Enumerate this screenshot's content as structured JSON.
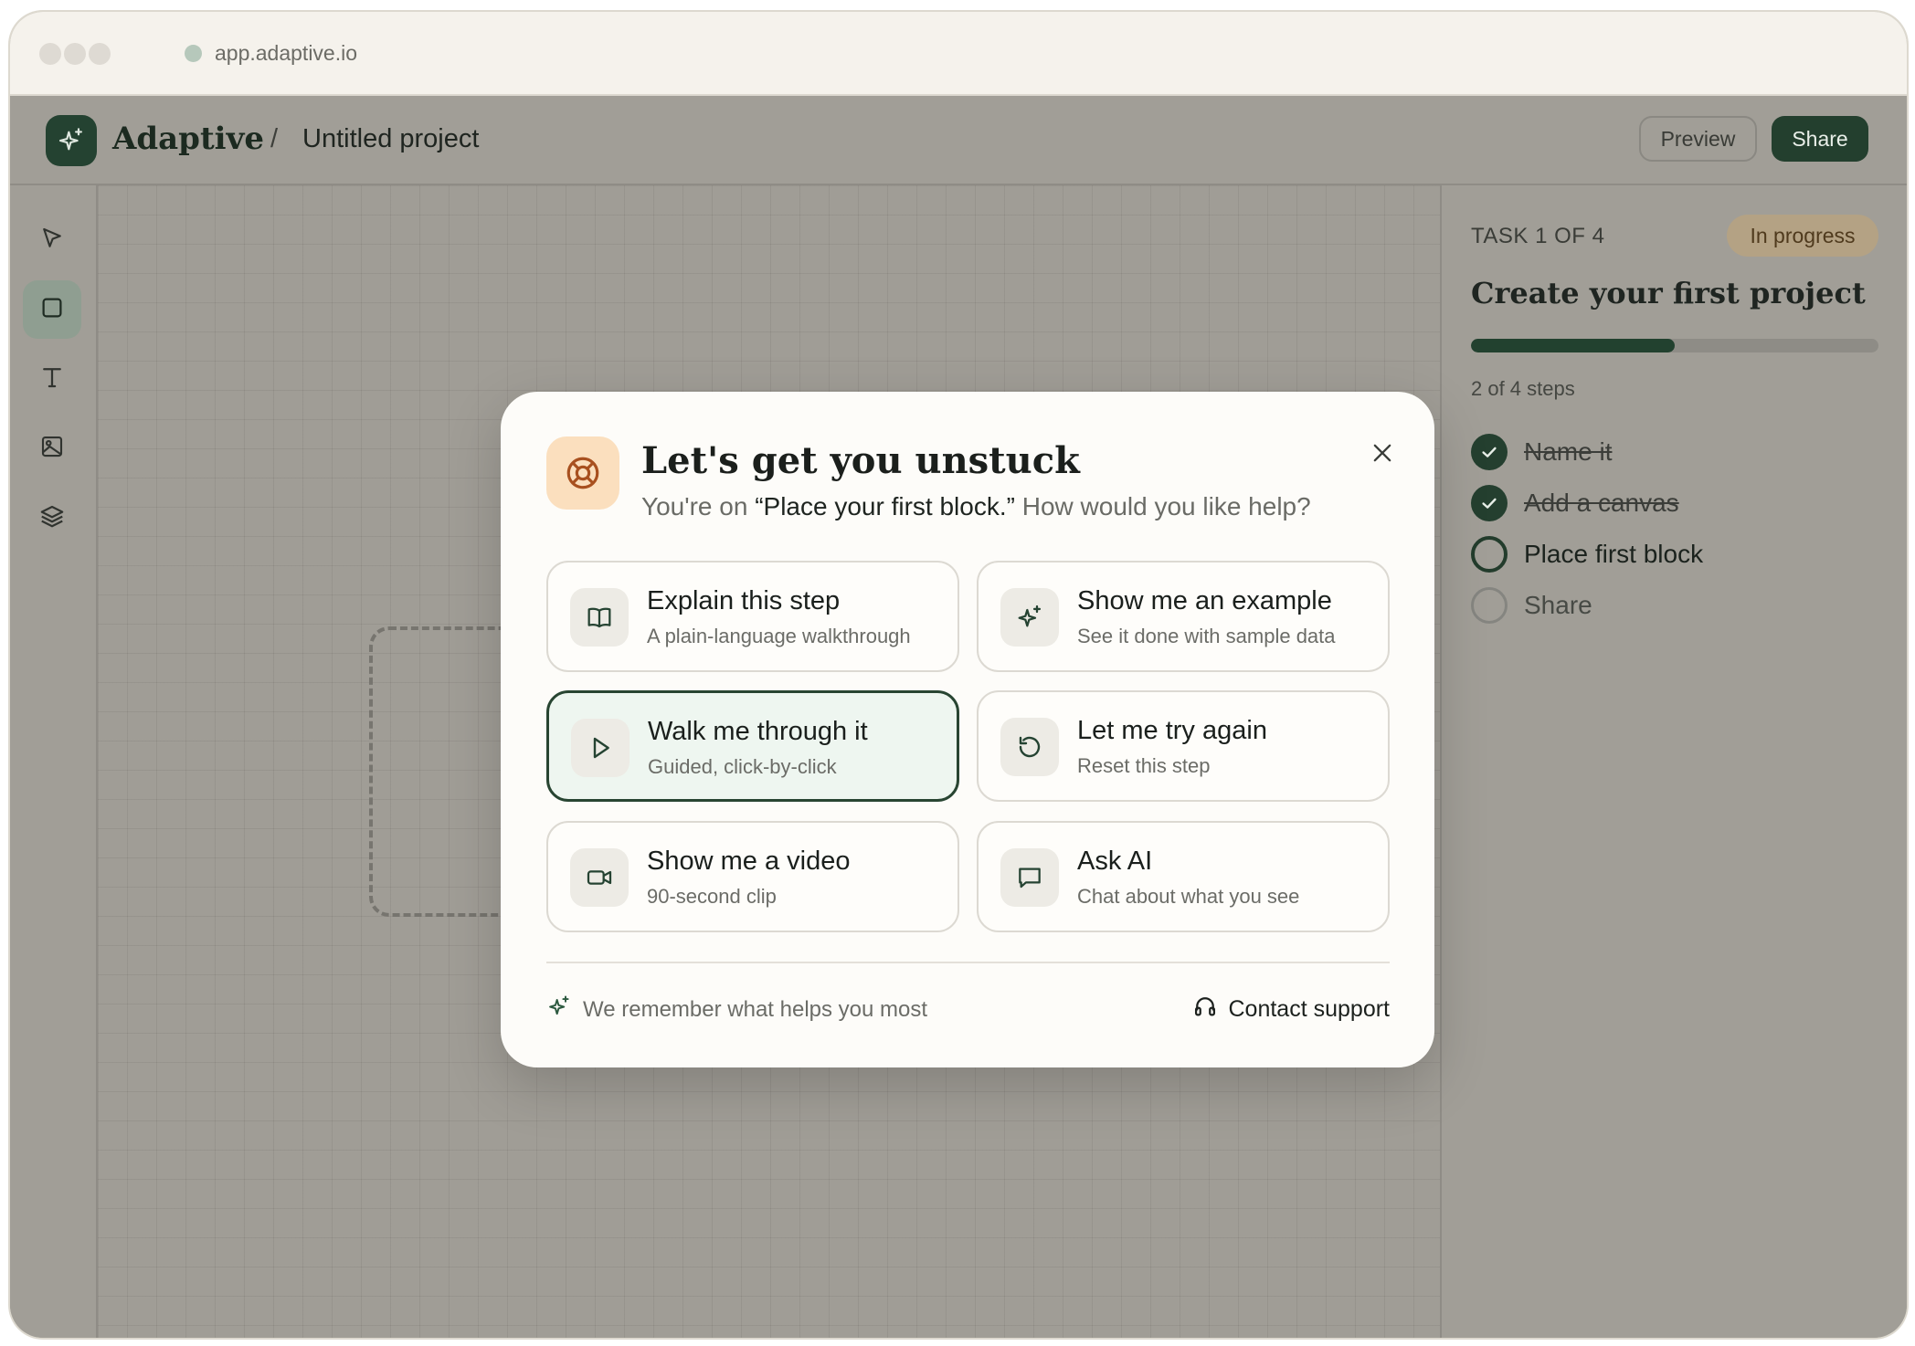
{
  "browser": {
    "url": "app.adaptive.io"
  },
  "header": {
    "brand": "Adaptive",
    "separator": "/",
    "project": "Untitled project",
    "preview_label": "Preview",
    "share_label": "Share"
  },
  "toolbar": {
    "tools": [
      {
        "name": "select",
        "icon": "cursor-icon",
        "active": false
      },
      {
        "name": "rectangle",
        "icon": "square-icon",
        "active": true
      },
      {
        "name": "text",
        "icon": "text-icon",
        "active": false
      },
      {
        "name": "image",
        "icon": "image-icon",
        "active": false
      },
      {
        "name": "layers",
        "icon": "layers-icon",
        "active": false
      }
    ]
  },
  "task_panel": {
    "task_label": "TASK 1 OF 4",
    "status": "In progress",
    "title": "Create your first project",
    "progress_fraction": 0.5,
    "steps_count": "2 of 4 steps",
    "steps": [
      {
        "label": "Name it",
        "state": "done"
      },
      {
        "label": "Add a canvas",
        "state": "done"
      },
      {
        "label": "Place first block",
        "state": "current"
      },
      {
        "label": "Share",
        "state": "todo"
      }
    ]
  },
  "modal": {
    "icon": "lifebuoy-icon",
    "title": "Let's get you unstuck",
    "subtitle_prefix": "You're on ",
    "subtitle_highlight": "“Place your first block.”",
    "subtitle_suffix": " How would you like help?",
    "options": [
      {
        "title": "Explain this step",
        "desc": "A plain-language walkthrough",
        "icon": "book-icon",
        "selected": false
      },
      {
        "title": "Show me an example",
        "desc": "See it done with sample data",
        "icon": "sparkle-icon",
        "selected": false
      },
      {
        "title": "Walk me through it",
        "desc": "Guided, click-by-click",
        "icon": "play-icon",
        "selected": true
      },
      {
        "title": "Let me try again",
        "desc": "Reset this step",
        "icon": "reset-icon",
        "selected": false
      },
      {
        "title": "Show me a video",
        "desc": "90-second clip",
        "icon": "video-icon",
        "selected": false
      },
      {
        "title": "Ask AI",
        "desc": "Chat about what you see",
        "icon": "chat-icon",
        "selected": false
      }
    ],
    "footer_note": "We remember what helps you most",
    "support_label": "Contact support"
  },
  "colors": {
    "brand_green": "#244231",
    "accent_orange_bg": "#fbdfbe",
    "selected_card_bg": "#eef6f0"
  }
}
